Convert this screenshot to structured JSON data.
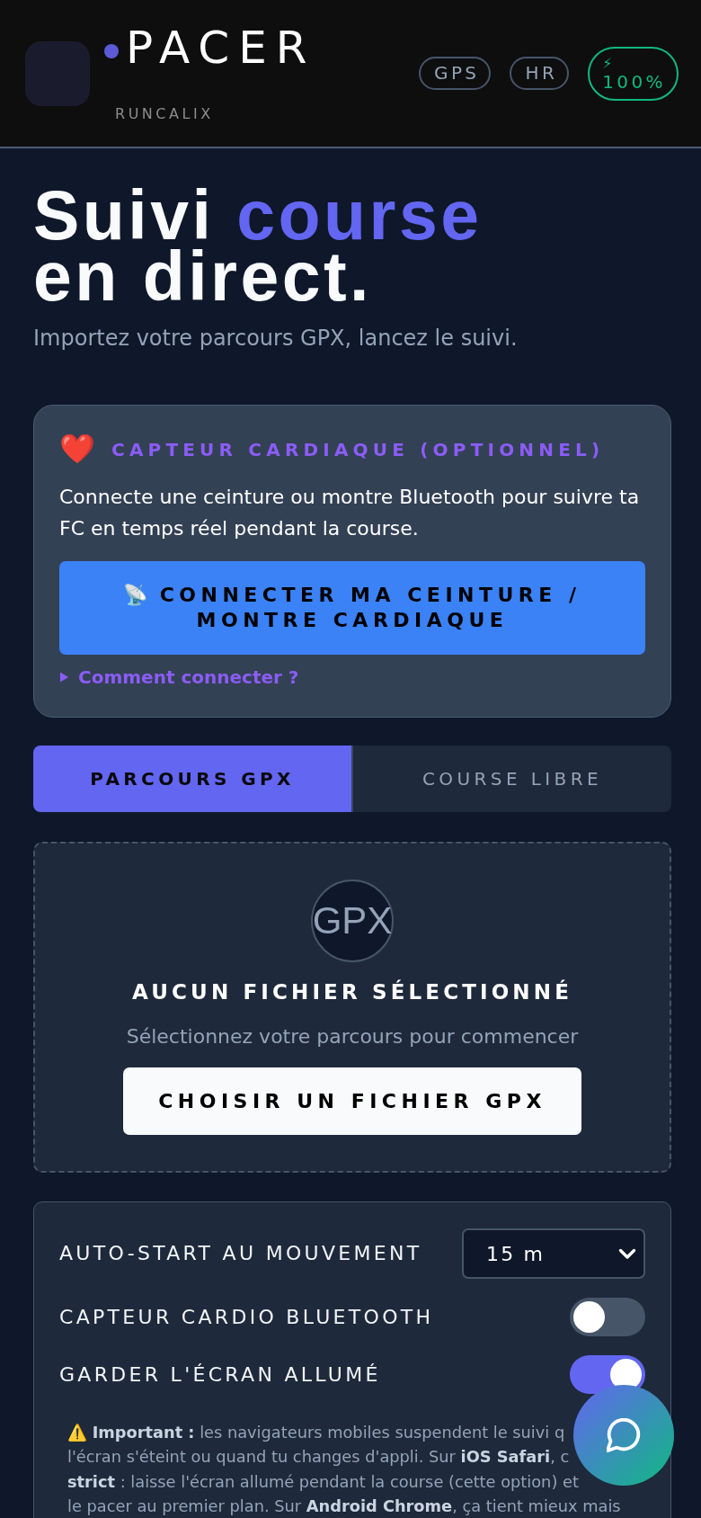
{
  "header": {
    "brand": {
      "name": "PACER",
      "tagline": "RUNCALIX"
    },
    "status_chips": [
      {
        "label": "GPS"
      },
      {
        "label": "HR"
      }
    ],
    "battery": {
      "icon": "⚡",
      "label": "100%"
    }
  },
  "hero": {
    "title_parts": [
      {
        "text": "Suivi",
        "accent": false
      },
      {
        "text": "course",
        "accent": true
      },
      {
        "text": "en direct.",
        "accent": false
      }
    ],
    "subtitle": "Importez votre parcours GPX, lancez le suivi."
  },
  "heart_sensor": {
    "icon": "❤️",
    "title": "CAPTEUR CARDIAQUE (OPTIONNEL)",
    "description": "Connecte une ceinture ou montre Bluetooth pour suivre ta FC en temps réel pendant la course.",
    "button": {
      "icon": "📡",
      "label": "CONNECTER MA CEINTURE / MONTRE CARDIAQUE"
    },
    "help": {
      "label": "Comment connecter ?",
      "expanded": false
    }
  },
  "tabs": [
    {
      "label": "PARCOURS GPX",
      "selected": true
    },
    {
      "label": "COURSE LIBRE",
      "selected": false
    }
  ],
  "upload": {
    "badge": "GPX",
    "title": "AUCUN FICHIER SÉLECTIONNÉ",
    "hint": "Sélectionnez votre parcours pour commencer",
    "button": "CHOISIR UN FICHIER GPX"
  },
  "settings": {
    "rows": [
      {
        "kind": "select",
        "label": "AUTO-START AU MOUVEMENT",
        "value": "15 m"
      },
      {
        "kind": "toggle",
        "label": "CAPTEUR CARDIO BLUETOOTH",
        "on": false
      },
      {
        "kind": "toggle",
        "label": "GARDER L'ÉCRAN ALLUMÉ",
        "on": true
      }
    ],
    "note": "⚠️ **Important :** les navigateurs mobiles suspendent le suivi q\nl'écran s'éteint ou quand tu changes d'appli. Sur **iOS Safari**, c\n**strict** : laisse l'écran allumé pendant la course (cette option) et\nle pacer au premier plan. Sur **Android Chrome**, ça tient mieux mais"
  }
}
